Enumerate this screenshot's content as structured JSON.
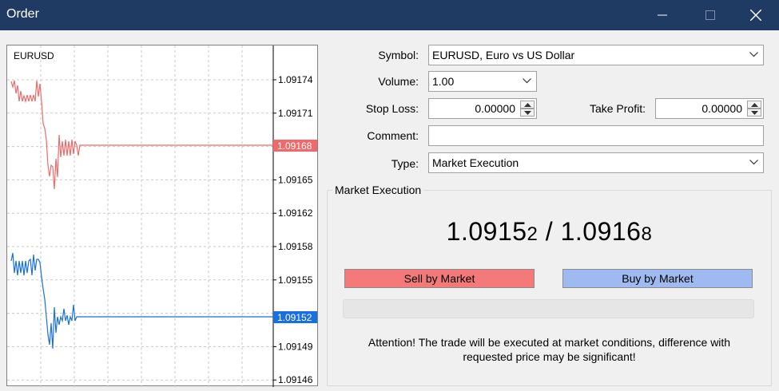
{
  "window": {
    "title": "Order"
  },
  "chart": {
    "symbol": "EURUSD",
    "ask_price_label": "1.09168",
    "bid_price_label": "1.09152",
    "ticks": [
      "1.09174",
      "1.09171",
      "1.09168",
      "1.09165",
      "1.09162",
      "1.09158",
      "1.09155",
      "1.09152",
      "1.09149",
      "1.09146"
    ],
    "ask_color": "#f06a6a",
    "bid_color": "#1a6fe0"
  },
  "form": {
    "symbol_label": "Symbol:",
    "symbol_value": "EURUSD, Euro vs US Dollar",
    "volume_label": "Volume:",
    "volume_value": "1.00",
    "stop_loss_label": "Stop Loss:",
    "stop_loss_value": "0.00000",
    "take_profit_label": "Take Profit:",
    "take_profit_value": "0.00000",
    "comment_label": "Comment:",
    "comment_value": "",
    "type_label": "Type:",
    "type_value": "Market Execution"
  },
  "execution": {
    "group_title": "Market Execution",
    "bid_main": "1.0915",
    "bid_small": "2",
    "separator": " / ",
    "ask_main": "1.0916",
    "ask_small": "8",
    "sell_label": "Sell by Market",
    "buy_label": "Buy by Market",
    "attention_line1": "Attention! The trade will be executed at market conditions, difference with",
    "attention_line2": "requested price may be significant!"
  }
}
